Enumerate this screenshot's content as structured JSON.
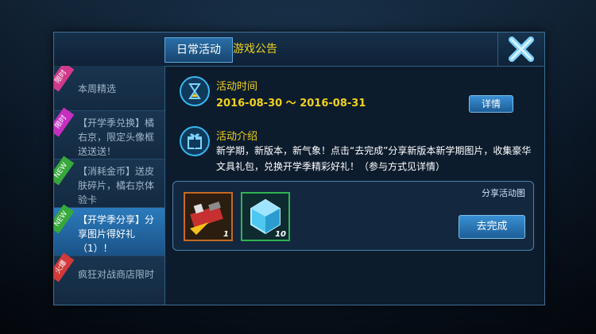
{
  "tabs": [
    {
      "label": "日常活动"
    },
    {
      "label": "游戏公告"
    }
  ],
  "sidebar": {
    "items": [
      {
        "badge": "限时",
        "label": "本周精选",
        "badge_color": "#d13a8a"
      },
      {
        "badge": "限时",
        "label": "【开学季兑换】橘右京，限定头像框送送送！",
        "badge_color": "#c42fc0"
      },
      {
        "badge": "NEW",
        "label": "【消耗金币】送皮肤碎片，橘右京体验卡",
        "badge_color": "#37a83b"
      },
      {
        "badge": "NEW",
        "label": "【开学季分享】分享图片得好礼（1）！",
        "badge_color": "#37a83b"
      },
      {
        "badge": "火爆",
        "label": "疯狂对战商店限时",
        "badge_color": "#d23a3a"
      }
    ]
  },
  "activity_time": {
    "title": "活动时间",
    "range": "2016-08-30 ～ 2016-08-31",
    "details_label": "详情"
  },
  "activity_intro": {
    "title": "活动介绍",
    "description": "新学期，新版本，新气象！点击“去完成”分享新版本新学期图片，收集豪华文具礼包，兑换开学季精彩好礼！（参与方式见详情）"
  },
  "reward": {
    "caption": "分享活动图",
    "complete_label": "去完成",
    "items": [
      {
        "name": "stationery-gift-pack",
        "qty": "1"
      },
      {
        "name": "blue-crystal",
        "qty": "10"
      }
    ]
  },
  "colors": {
    "accent_yellow": "#f0d21b",
    "accent_blue": "#37b8f0"
  }
}
